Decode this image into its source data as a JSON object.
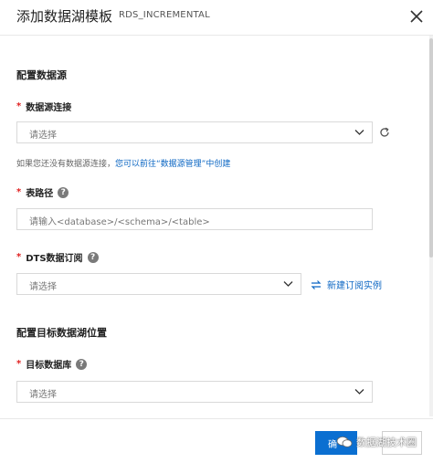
{
  "header": {
    "title": "添加数据湖模板",
    "subtitle": "RDS_INCREMENTAL"
  },
  "sections": {
    "source_title": "配置数据源",
    "target_title": "配置目标数据湖位置"
  },
  "fields": {
    "source_conn": {
      "label": "数据源连接",
      "placeholder": "请选择"
    },
    "source_hint": {
      "text": "如果您还没有数据源连接，",
      "link": "您可以前往“数据源管理”中创建"
    },
    "table_path": {
      "label": "表路径",
      "placeholder": "请输入<database>/<schema>/<table>"
    },
    "dts": {
      "label": "DTS数据订阅",
      "placeholder": "请选择",
      "side_link": "新建订阅实例"
    },
    "target_db": {
      "label": "目标数据库",
      "placeholder": "请选择"
    }
  },
  "footer": {
    "confirm_label": "确",
    "watermark": "数据湖技术圈"
  },
  "colors": {
    "primary": "#0b6fd1",
    "link": "#0b66c3",
    "required": "#e02020"
  }
}
